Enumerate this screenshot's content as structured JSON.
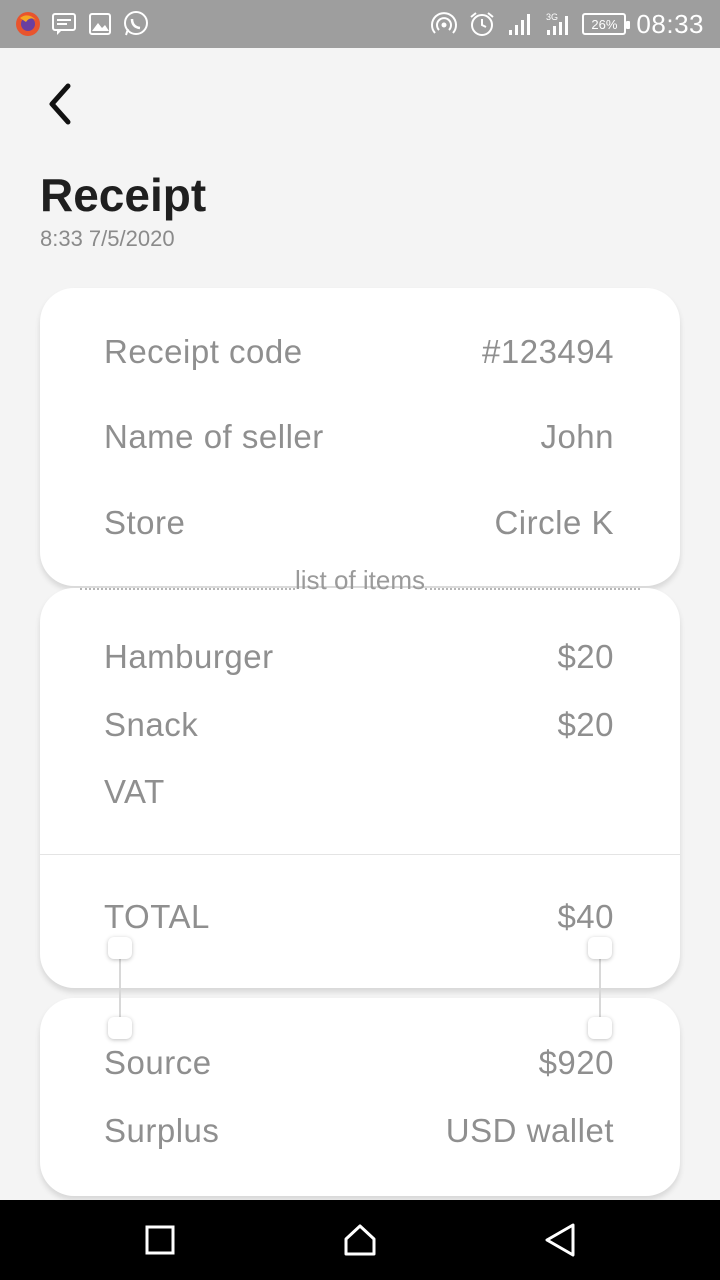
{
  "status_bar": {
    "time": "08:33",
    "battery": "26%",
    "network": "3G",
    "left_icons": [
      "firefox-icon",
      "message-icon",
      "image-icon",
      "whatsapp-icon"
    ],
    "right_icons": [
      "hotspot-icon",
      "alarm-icon",
      "signal-icon",
      "signal-3g-icon",
      "battery-icon"
    ]
  },
  "header": {
    "back_icon": "chevron-left-icon",
    "title": "Receipt",
    "datetime": "8:33 7/5/2020"
  },
  "details": [
    {
      "label": "Receipt code",
      "value": "#123494"
    },
    {
      "label": "Name of seller",
      "value": "John"
    },
    {
      "label": "Store",
      "value": "Circle K"
    }
  ],
  "items_divider": "list of items",
  "items": [
    {
      "label": "Hamburger",
      "value": "$20"
    },
    {
      "label": "Snack",
      "value": "$20"
    },
    {
      "label": "VAT",
      "value": ""
    }
  ],
  "total": {
    "label": "TOTAL",
    "value": "$40"
  },
  "payment": [
    {
      "label": "Source",
      "value": "$920"
    },
    {
      "label": "Surplus",
      "value": "USD wallet"
    }
  ],
  "nav_bar": {
    "recent_icon": "square-recent-icon",
    "home_icon": "home-icon",
    "back_icon": "triangle-back-icon"
  },
  "colors": {
    "status_bar": "#9e9e9e",
    "background": "#f4f4f4",
    "card": "#ffffff",
    "text_primary": "#1f1f1f",
    "text_secondary": "#8f8f8f",
    "nav_bar": "#000000"
  }
}
